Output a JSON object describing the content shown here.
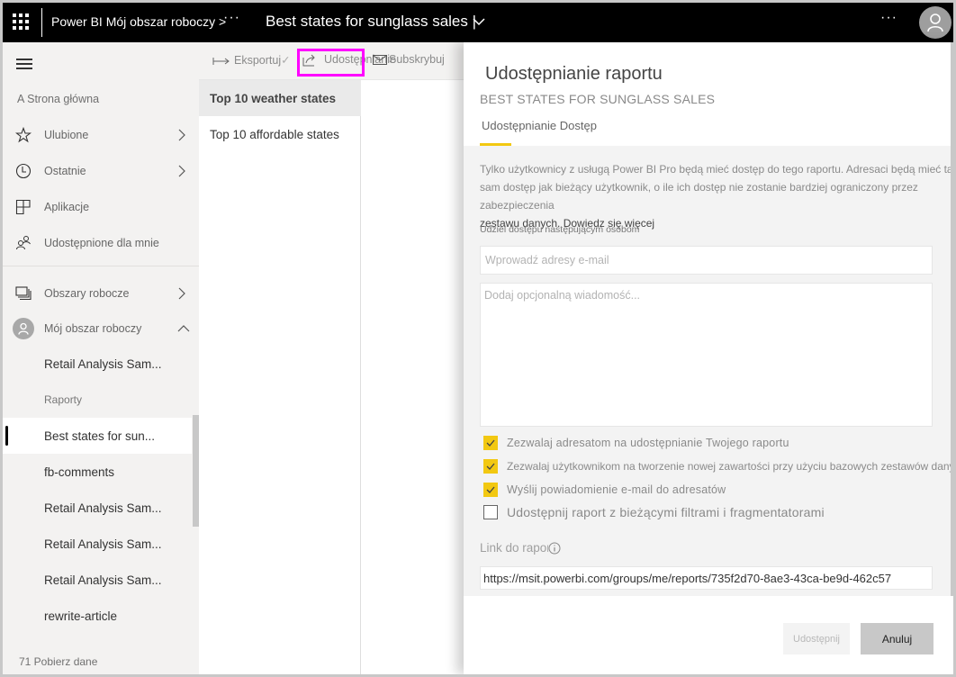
{
  "topbar": {
    "breadcrumb": "Power BI Mój obszar roboczy >",
    "more_label": "···",
    "report_title": "Best states for sunglass sales  |",
    "overflow_label": "···",
    "icons": {
      "app_launcher": "waffle-icon",
      "title_menu": "chevron-down-icon",
      "account": "person-icon"
    }
  },
  "sidebar": {
    "home": "A Strona główna",
    "nav": [
      {
        "label": "Ulubione",
        "icon": "star-icon",
        "has_chevron": true
      },
      {
        "label": "Ostatnie",
        "icon": "clock-icon",
        "has_chevron": true
      },
      {
        "label": "Aplikacje",
        "icon": "apps-icon",
        "has_chevron": false
      },
      {
        "label": "Udostępnione dla mnie",
        "icon": "shared-people-icon",
        "has_chevron": false
      }
    ],
    "workspaces": {
      "label": "Obszary robocze",
      "icon": "workspaces-icon"
    },
    "my_workspace": {
      "label": "Mój obszar roboczy",
      "icon": "person-icon",
      "expanded": true
    },
    "items": [
      {
        "label": "Retail Analysis Sam...",
        "active": false
      },
      {
        "label": "Best states for sun...",
        "active": true
      },
      {
        "label": "fb-comments",
        "active": false
      },
      {
        "label": "Retail Analysis Sam...",
        "active": false
      },
      {
        "label": "Retail Analysis Sam...",
        "active": false
      },
      {
        "label": "Retail Analysis Sam...",
        "active": false
      },
      {
        "label": "rewrite-article",
        "active": false
      }
    ],
    "section_reports": "Raporty",
    "footer": "71 Pobierz dane"
  },
  "toolbar": {
    "export": "Eksportuj",
    "share": "Udostępnianie",
    "subscribe": "Subskrybuj",
    "highlight_color": "#ff00ff"
  },
  "pages": [
    {
      "label": "Top 10 weather states",
      "active": true
    },
    {
      "label": "Top 10 affordable states",
      "active": false
    }
  ],
  "dialog": {
    "title": "Udostępnianie raportu",
    "subtitle": "BEST STATES FOR SUNGLASS SALES",
    "tabs": "Udostępnianie Dostęp",
    "accent_color": "#f2c811",
    "info_text": "Tylko użytkownicy z usługą Power BI Pro będą mieć dostęp do tego raportu. Adresaci będą mieć taki sam dostęp jak bieżący użytkownik, o ile ich dostęp nie zostanie bardziej ograniczony przez zabezpieczenia",
    "info_link": "zestawu danych. Dowiedz się więcej",
    "grant_label": "Udziel dostępu następującym osobom",
    "email_placeholder": "Wprowadź adresy e-mail",
    "email_value": "",
    "message_placeholder": "Dodaj opcjonalną wiadomość...",
    "message_value": "",
    "checkboxes": [
      {
        "label": "Zezwalaj  adresatom  na  udostępnianie  Twojego  raportu",
        "checked": true
      },
      {
        "label": "Zezwalaj użytkownikom na tworzenie nowej zawartości przy użyciu bazowych zestawów danych",
        "checked": true
      },
      {
        "label": "Wyślij  powiadomienie  e-mail  do  adresatów",
        "checked": true
      },
      {
        "label": "Udostępnij raport z bieżącymi filtrami i fragmentatorami",
        "checked": false
      }
    ],
    "link_label": "Link do raportu",
    "link_value": "https://msit.powerbi.com/groups/me/reports/735f2d70-8ae3-43ca-be9d-462c57",
    "share_button": "Udostępnij",
    "cancel_button": "Anuluj"
  }
}
